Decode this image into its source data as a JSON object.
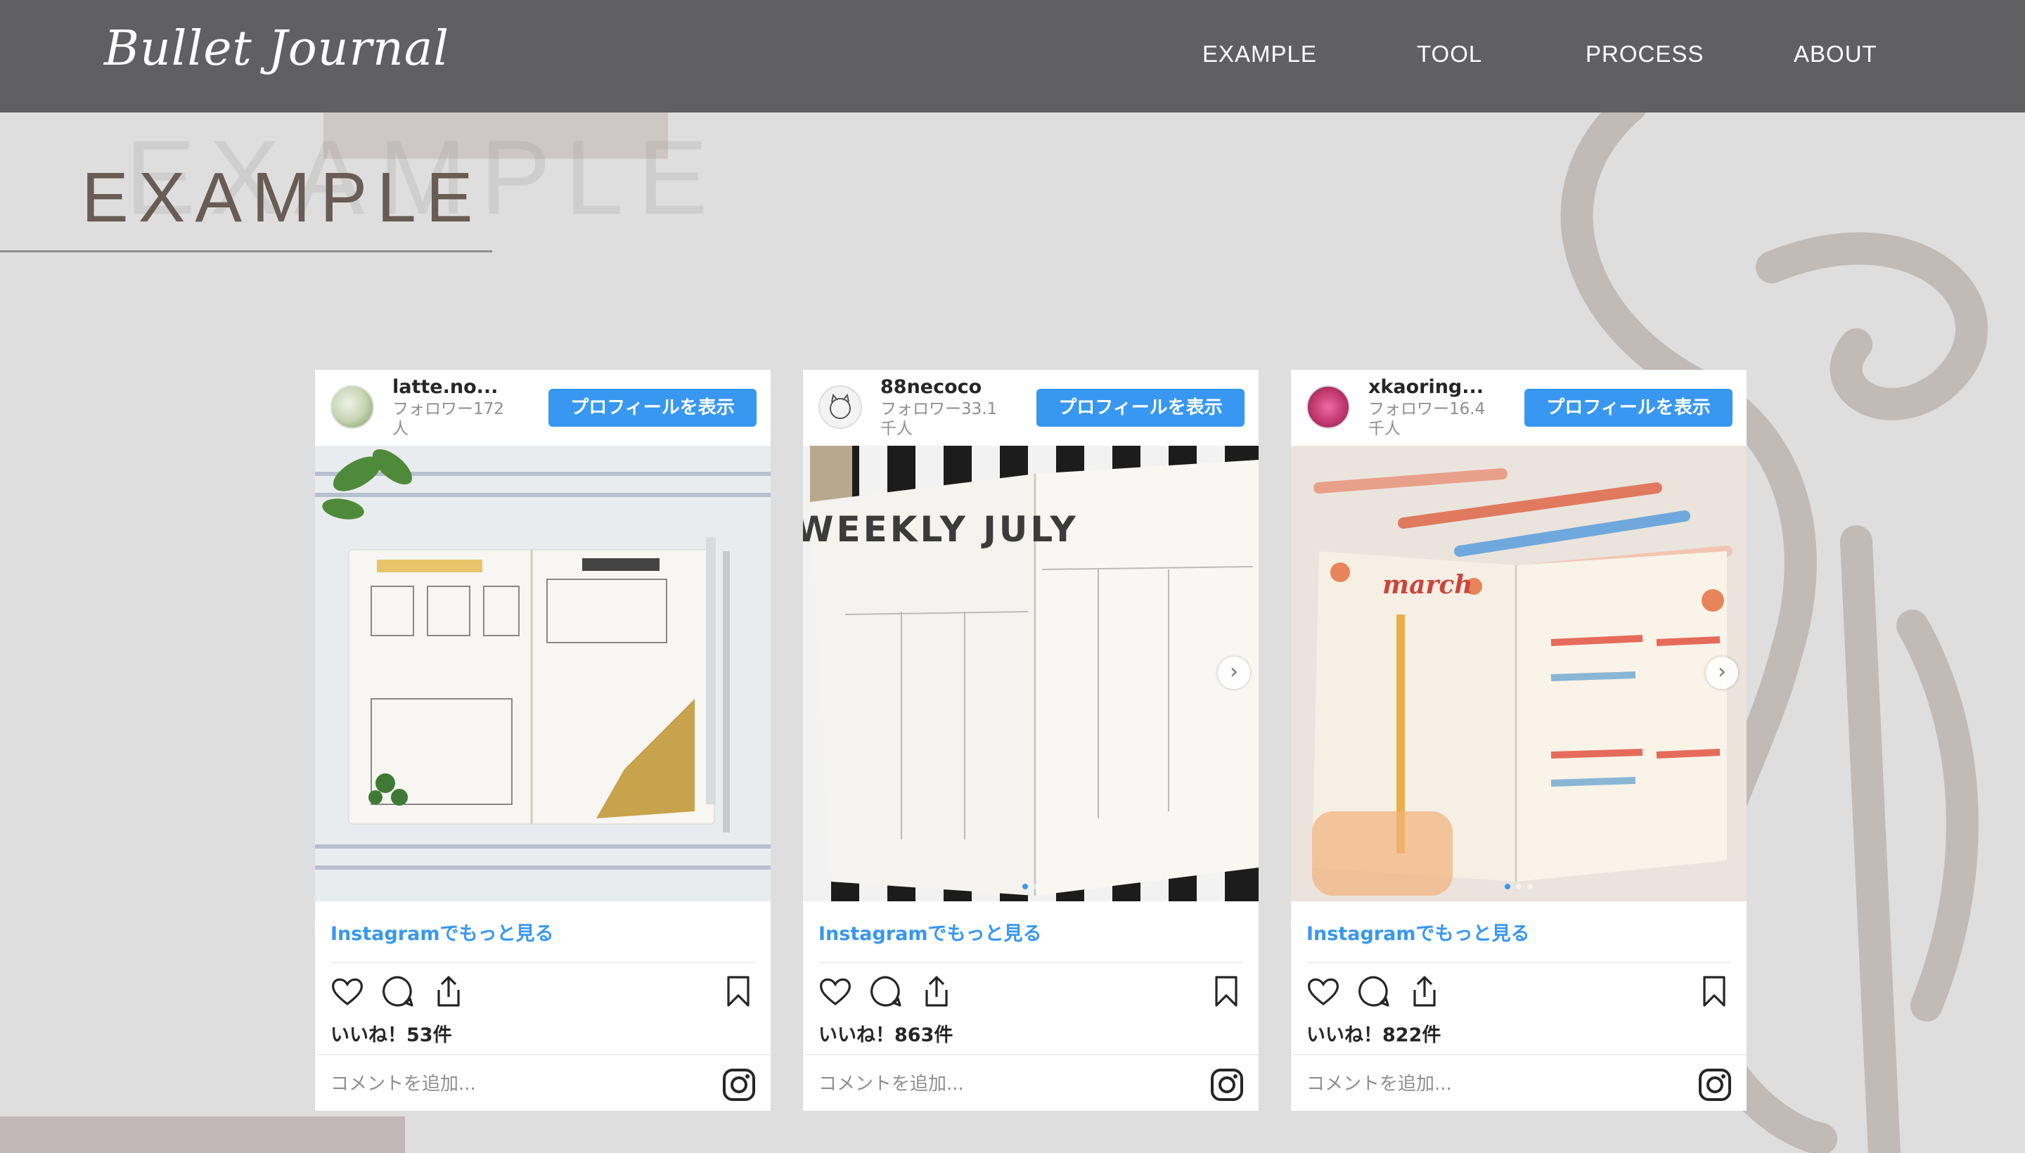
{
  "header": {
    "logo": "Bullet Journal",
    "nav": [
      "EXAMPLE",
      "TOOL",
      "PROCESS",
      "ABOUT"
    ]
  },
  "page": {
    "title": "EXAMPLE",
    "ghost_title": "EXAMPLE"
  },
  "colors": {
    "header_bg": "#606063",
    "page_bg": "#dededf",
    "title": "#685c54",
    "button_blue": "#3897f0",
    "decor_rect_top": "#cdc8c6",
    "decor_rect_bottom": "#c2b7b8"
  },
  "cards": [
    {
      "username": "latte.no...",
      "followers": "フォロワー172人",
      "profile_button": "プロフィールを表示",
      "more_link": "Instagramでもっと見る",
      "likes": "いいね！53件",
      "comment_placeholder": "コメントを追加...",
      "photo_caption": "",
      "has_next_arrow": false
    },
    {
      "username": "88necoco",
      "followers": "フォロワー33.1千人",
      "profile_button": "プロフィールを表示",
      "more_link": "Instagramでもっと見る",
      "likes": "いいね！863件",
      "comment_placeholder": "コメントを追加...",
      "photo_caption": "WEEKLY JULY",
      "has_next_arrow": true
    },
    {
      "username": "xkaoring...",
      "followers": "フォロワー16.4千人",
      "profile_button": "プロフィールを表示",
      "more_link": "Instagramでもっと見る",
      "likes": "いいね！822件",
      "comment_placeholder": "コメントを追加...",
      "photo_caption": "march",
      "has_next_arrow": true
    }
  ],
  "icons": {
    "like": "heart-icon",
    "comment": "comment-icon",
    "share": "share-icon",
    "save": "bookmark-icon",
    "brand": "instagram-icon"
  }
}
